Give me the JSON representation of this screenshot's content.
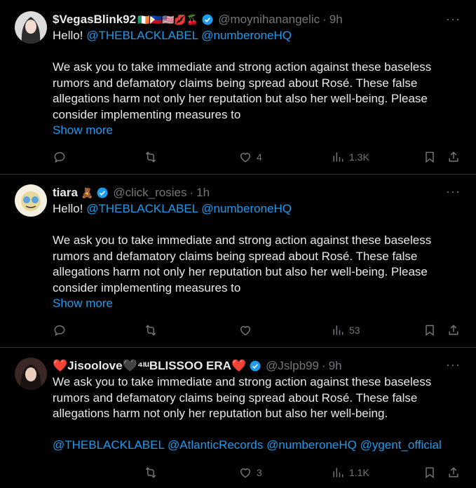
{
  "tweets": [
    {
      "name": "$VegasBlink92",
      "name_emoji": "🇮🇪🇵🇭🇺🇸💋🍒",
      "handle": "@moynihanangelic",
      "time": "9h",
      "greeting_prefix": "Hello! ",
      "mention1": "@THEBLACKLABEL",
      "mention2": "@numberoneHQ",
      "body": "We ask you to take immediate and strong action against these baseless rumors and defamatory claims being spread about Rosé. These false allegations harm not only her reputation but also her well-being. Please consider implementing measures to",
      "show_more": "Show more",
      "likes": "4",
      "views": "1.3K"
    },
    {
      "name": "tiara",
      "name_emoji": "🧸",
      "handle": "@click_rosies",
      "time": "1h",
      "greeting_prefix": "Hello! ",
      "mention1": "@THEBLACKLABEL",
      "mention2": "@numberoneHQ",
      "body": "We ask you to take immediate and strong action against these baseless rumors and defamatory claims being spread about Rosé. These false allegations harm not only her reputation but also her well-being. Please consider implementing measures to",
      "show_more": "Show more",
      "likes": "",
      "views": "53"
    },
    {
      "name": "❤️Jisoolove🖤⁴ᶦᵘBLISSOO ERA❤️",
      "handle": "@Jslpb99",
      "time": "9h",
      "body": "We ask you to take immediate and strong action against these baseless rumors and defamatory claims being spread about Rosé. These false allegations harm not only her reputation but also her well-being.",
      "mentions": [
        "@THEBLACKLABEL",
        "@AtlanticRecords",
        "@numberoneHQ",
        "@ygent_official"
      ],
      "likes": "3",
      "views": "1.1K"
    }
  ],
  "colors": {
    "background": "#000000",
    "text": "#e7e9ea",
    "secondary": "#71767b",
    "link": "#1d9bf0",
    "verified": "#1d9bf0"
  },
  "icons": [
    "reply-icon",
    "retweet-icon",
    "like-icon",
    "views-icon",
    "bookmark-icon",
    "share-icon",
    "verified-icon",
    "more-icon"
  ]
}
